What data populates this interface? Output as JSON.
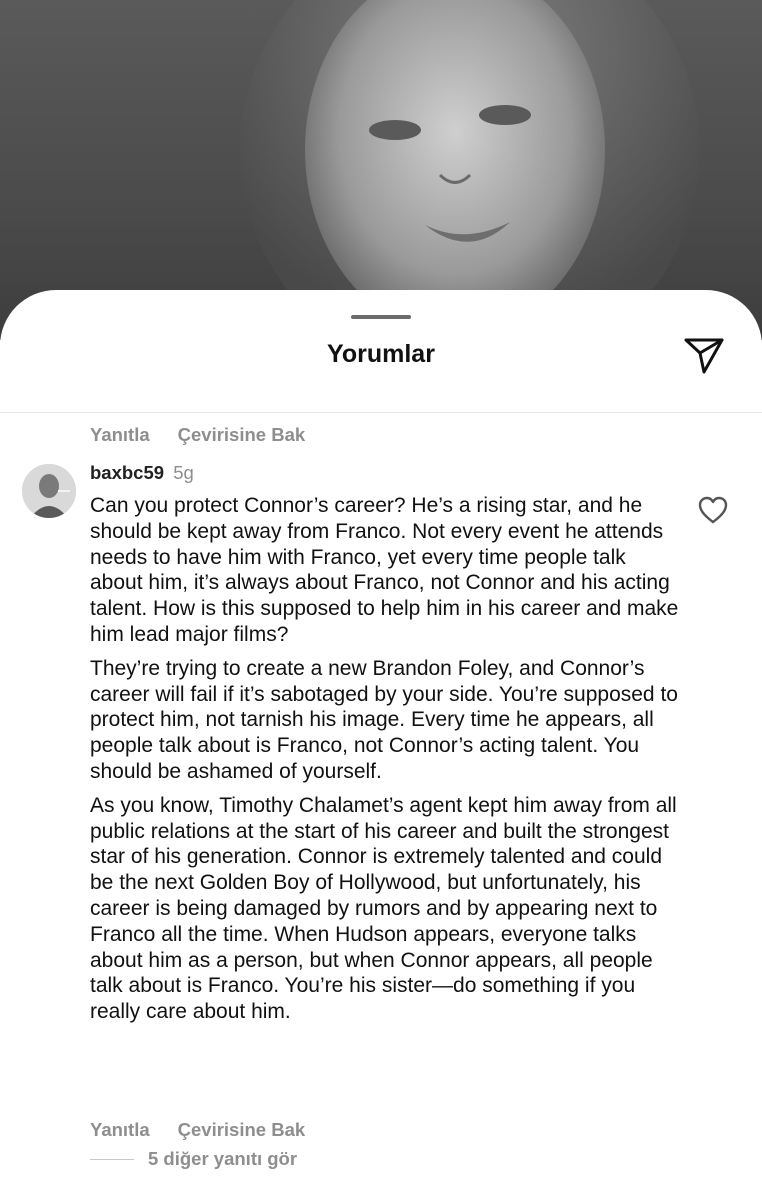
{
  "sheet": {
    "title": "Yorumlar"
  },
  "icons": {
    "share": "paper-plane-icon",
    "like": "heart-outline-icon"
  },
  "prev_comment_actions": {
    "reply": "Yanıtla",
    "translate": "Çevirisine Bak"
  },
  "comment": {
    "username": "baxbc59",
    "time": "5g",
    "paragraphs": [
      "Can you protect Connor’s career? He’s a rising star, and he should be kept away from Franco. Not every event he attends needs to have him with Franco, yet every time people talk about him, it’s always about Franco, not Connor and his acting talent. How is this supposed to help him in his career and make him lead major films?",
      "They’re trying to create a new Brandon Foley, and Connor’s career will fail if it’s sabotaged by your side. You’re supposed to protect him, not tarnish his image. Every time he appears, all people talk about is Franco, not Connor’s acting talent. You should be ashamed of yourself.",
      "As you know, Timothy Chalamet’s agent kept him away from all public relations at the start of his career and built the strongest star of his generation. Connor is extremely talented and could be the next Golden Boy of Hollywood, but unfortunately, his career is being damaged by rumors and by appearing next to Franco all the time. When Hudson appears, everyone talks about him as a person, but when Connor appears, all people talk about is Franco. You’re his sister—do something if you really care about him."
    ],
    "actions": {
      "reply": "Yanıtla",
      "translate": "Çevirisine Bak"
    },
    "more_replies": "5 diğer yanıtı gör"
  }
}
